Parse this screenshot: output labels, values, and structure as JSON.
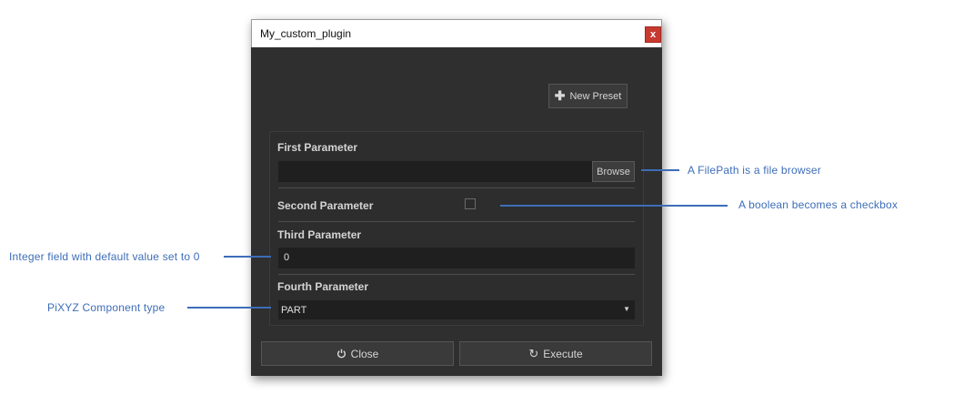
{
  "window": {
    "title": "My_custom_plugin",
    "close_glyph": "x",
    "new_preset_label": "New Preset",
    "params": {
      "first": {
        "label": "First Parameter",
        "value": "",
        "browse_label": "Browse"
      },
      "second": {
        "label": "Second Parameter",
        "checked": false
      },
      "third": {
        "label": "Third Parameter",
        "value": "0"
      },
      "fourth": {
        "label": "Fourth Parameter",
        "selected": "PART"
      }
    },
    "close_label": "Close",
    "execute_label": "Execute"
  },
  "annotations": {
    "filepath": "A FilePath is a file browser",
    "boolean": "A boolean becomes a checkbox",
    "integer": "Integer field with default value set to 0",
    "component": "PiXYZ Component type"
  },
  "colors": {
    "accent": "#3d6db8",
    "window_bg": "#2f2f2f",
    "close_button": "#c8392f"
  },
  "icons": [
    "plus-icon",
    "power-icon",
    "refresh-icon",
    "dropdown-arrow-icon",
    "close-icon"
  ]
}
